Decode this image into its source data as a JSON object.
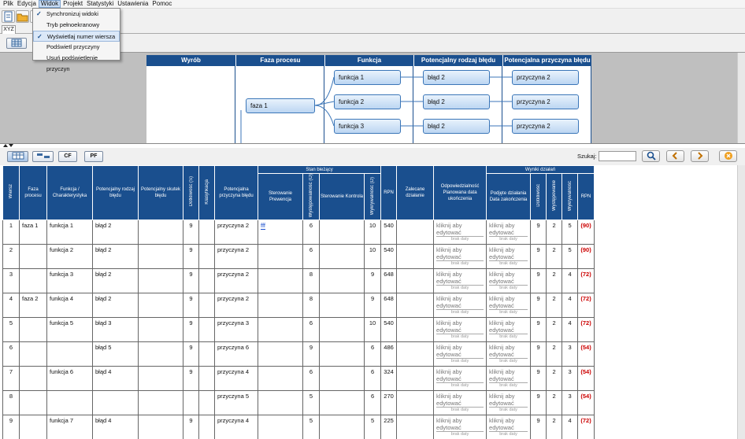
{
  "menu": [
    "Plik",
    "Edycja",
    "Widok",
    "Projekt",
    "Statystyki",
    "Ustawienia",
    "Pomoc"
  ],
  "tabName": "XYZ",
  "dropdown": {
    "items": [
      {
        "label": "Synchronizuj widoki",
        "checked": true
      },
      {
        "label": "Tryb pełnoekranowy",
        "checked": false
      },
      {
        "label": "Wyświetlaj numer wiersza",
        "checked": true
      },
      {
        "label": "Podświetl przyczyny",
        "checked": false
      },
      {
        "label": "Usuń podświetlenie przyczyn",
        "checked": false
      }
    ]
  },
  "diagram": {
    "headers": [
      "Wyrób",
      "Faza procesu",
      "Funkcja",
      "Potencjalny rodzaj błędu",
      "Potencjalna przyczyna błędu"
    ],
    "phase": "faza 1",
    "functions": [
      "funkcja 1",
      "funkcja 2",
      "funkcja 3"
    ],
    "errors": [
      "błąd 2",
      "błąd 2",
      "błąd 2"
    ],
    "causes": [
      "przyczyna 2",
      "przyczyna 2",
      "przyczyna 2"
    ]
  },
  "search": {
    "label": "Szukaj:"
  },
  "bottomButtons": [
    "CF",
    "PF"
  ],
  "grid": {
    "headers": {
      "wiersz": "Wiersz",
      "faza": "Faza procesu",
      "funkcja": "Funkcja / Charakterystyka",
      "blad": "Potencjalny rodzaj błędu",
      "skutek": "Potencjalny skutek błędu",
      "dotk": "Dotkliwość (S)",
      "klas": "Klasyfikacja",
      "przycz": "Potencjalna przyczyna błędu",
      "stan": "Stan bieżący",
      "sterPrew": "Sterowanie Prewencja",
      "wyst": "Występowalność (O)",
      "sterKontr": "Sterowanie Kontrola",
      "wykr": "Wykrywalność (D)",
      "rpn": "RPN",
      "zalec": "Zalecane działanie",
      "odpow": "Odpowiedzialność Planowana data ukończenia",
      "wyniki": "Wyniki działań",
      "podjete": "Podjęte działania Data zakończenia",
      "w_dotk": "Dotkliwość",
      "w_wyst": "Występowanie",
      "w_wykr": "Wykrywalność",
      "w_rpn": "RPN"
    },
    "edit": "kliknij aby edytować",
    "brak": "brak daty",
    "rows": [
      {
        "nr": "1",
        "faza": "faza 1",
        "funkcja": "funkcja 1",
        "blad": "błąd 2",
        "s": "9",
        "przycz": "przyczyna 2",
        "prew": "fff",
        "o": "6",
        "d": "10",
        "rpn": "540",
        "ws": "9",
        "wo": "2",
        "wd": "5",
        "wrpn": "(90)"
      },
      {
        "nr": "2",
        "faza": "",
        "funkcja": "funkcja 2",
        "blad": "błąd 2",
        "s": "9",
        "przycz": "przyczyna 2",
        "prew": "",
        "o": "6",
        "d": "10",
        "rpn": "540",
        "ws": "9",
        "wo": "2",
        "wd": "5",
        "wrpn": "(90)"
      },
      {
        "nr": "3",
        "faza": "",
        "funkcja": "funkcja 3",
        "blad": "błąd 2",
        "s": "9",
        "przycz": "przyczyna 2",
        "prew": "",
        "o": "8",
        "d": "9",
        "rpn": "648",
        "ws": "9",
        "wo": "2",
        "wd": "4",
        "wrpn": "(72)"
      },
      {
        "nr": "4",
        "faza": "faza 2",
        "funkcja": "funkcja 4",
        "blad": "błąd 2",
        "s": "9",
        "przycz": "przyczyna 2",
        "prew": "",
        "o": "8",
        "d": "9",
        "rpn": "648",
        "ws": "9",
        "wo": "2",
        "wd": "4",
        "wrpn": "(72)"
      },
      {
        "nr": "5",
        "faza": "",
        "funkcja": "funkcja 5",
        "blad": "błąd 3",
        "s": "9",
        "przycz": "przyczyna 3",
        "prew": "",
        "o": "6",
        "d": "10",
        "rpn": "540",
        "ws": "9",
        "wo": "2",
        "wd": "4",
        "wrpn": "(72)"
      },
      {
        "nr": "6",
        "faza": "",
        "funkcja": "",
        "blad": "błąd 5",
        "s": "9",
        "przycz": "przyczyna 6",
        "prew": "",
        "o": "9",
        "d": "6",
        "rpn": "486",
        "ws": "9",
        "wo": "2",
        "wd": "3",
        "wrpn": "(54)"
      },
      {
        "nr": "7",
        "faza": "",
        "funkcja": "funkcja 6",
        "blad": "błąd 4",
        "s": "9",
        "przycz": "przyczyna 4",
        "prew": "",
        "o": "6",
        "d": "6",
        "rpn": "324",
        "ws": "9",
        "wo": "2",
        "wd": "3",
        "wrpn": "(54)"
      },
      {
        "nr": "8",
        "faza": "",
        "funkcja": "",
        "blad": "",
        "s": "",
        "przycz": "przyczyna 5",
        "prew": "",
        "o": "5",
        "d": "6",
        "rpn": "270",
        "ws": "9",
        "wo": "2",
        "wd": "3",
        "wrpn": "(54)"
      },
      {
        "nr": "9",
        "faza": "",
        "funkcja": "funkcja 7",
        "blad": "błąd 4",
        "s": "9",
        "przycz": "przyczyna 4",
        "prew": "",
        "o": "5",
        "d": "5",
        "rpn": "225",
        "ws": "9",
        "wo": "2",
        "wd": "4",
        "wrpn": "(72)"
      }
    ]
  }
}
